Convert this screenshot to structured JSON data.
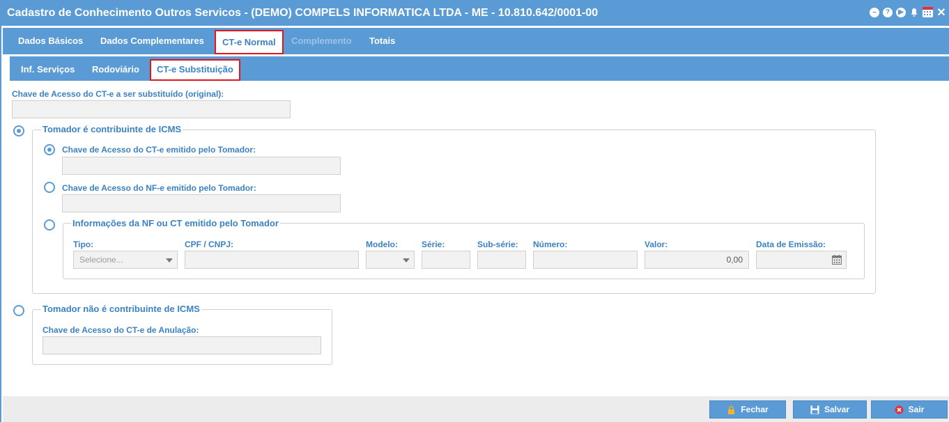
{
  "window": {
    "title": "Cadastro de Conhecimento Outros Servicos - (DEMO) COMPELS INFORMATICA LTDA - ME - 10.810.642/0001-00"
  },
  "main_tabs": [
    {
      "label": "Dados Básicos"
    },
    {
      "label": "Dados Complementares"
    },
    {
      "label": "CT-e Normal"
    },
    {
      "label": "Complemento"
    },
    {
      "label": "Totais"
    }
  ],
  "sub_tabs": [
    {
      "label": "Inf. Serviços"
    },
    {
      "label": "Rodoviário"
    },
    {
      "label": "CT-e Substituição"
    }
  ],
  "form": {
    "chave_original_label": "Chave de Acesso do CT-e a ser substituído (original):",
    "chave_original_value": "",
    "contribuinte": {
      "legend": "Tomador é contribuinte de ICMS",
      "cte_tomador_label": "Chave de Acesso do CT-e emitido pelo Tomador:",
      "cte_tomador_value": "",
      "nfe_tomador_label": "Chave de Acesso do NF-e emitido pelo Tomador:",
      "nfe_tomador_value": "",
      "info_nf": {
        "legend": "Informações da NF ou CT emitido pelo Tomador",
        "tipo_label": "Tipo:",
        "tipo_value": "Selecione...",
        "cpf_label": "CPF / CNPJ:",
        "modelo_label": "Modelo:",
        "serie_label": "Série:",
        "subserie_label": "Sub-série:",
        "numero_label": "Número:",
        "valor_label": "Valor:",
        "valor_value": "0,00",
        "data_label": "Data de Emissão:"
      }
    },
    "nao_contribuinte": {
      "legend": "Tomador não é contribuinte de ICMS",
      "anulacao_label": "Chave de Acesso do CT-e de Anulação:",
      "anulacao_value": ""
    }
  },
  "footer": {
    "fechar": "Fechar",
    "salvar": "Salvar",
    "sair": "Sair"
  },
  "colors": {
    "accent": "#5b9bd5",
    "highlight": "#e0181e",
    "danger": "#e0303a"
  }
}
